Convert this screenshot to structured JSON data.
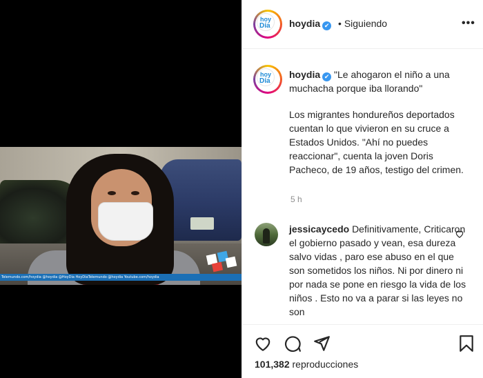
{
  "account": {
    "username": "hoydia",
    "logo_line1": "hoy",
    "logo_line2": "Día",
    "verified_mark": "✔",
    "follow_separator": "•",
    "follow_status": "Siguiendo",
    "more_icon": "more-horizontal-icon"
  },
  "caption": {
    "quote": "\"Le ahogaron el niño a una muchacha porque iba llorando\"",
    "body": "Los migrantes hondureños deportados cuentan lo que vivieron en su cruce a Estados Unidos. \"Ahí no puedes reaccionar\", cuenta la joven Doris Pacheco, de 19 años, testigo del crimen.",
    "time": "5 h"
  },
  "comment": {
    "username": "jessicaycedo",
    "text": "Definitivamente, Criticaron el gobierno pasado y vean, esa dureza salvo vidas , paro ese abuso en el que son sometidos los niños. Ni por dinero ni por nada se pone en riesgo la vida de los niños . Esto no va a parar si las leyes no son"
  },
  "video": {
    "ticker_text": "Telemundo.com/hoydia     @hoydia     @HoyDia     HoyDiaTelemundo     @hoydia     Youtube.com/hoydia"
  },
  "actions": {
    "views_count": "101,382",
    "views_label": "reproducciones",
    "icons": [
      "heart-icon",
      "comment-icon",
      "share-icon",
      "bookmark-icon"
    ]
  },
  "colors": {
    "verified": "#3897f0",
    "brand_blue": "#1e8ad6",
    "muted": "#8e8e8e"
  }
}
